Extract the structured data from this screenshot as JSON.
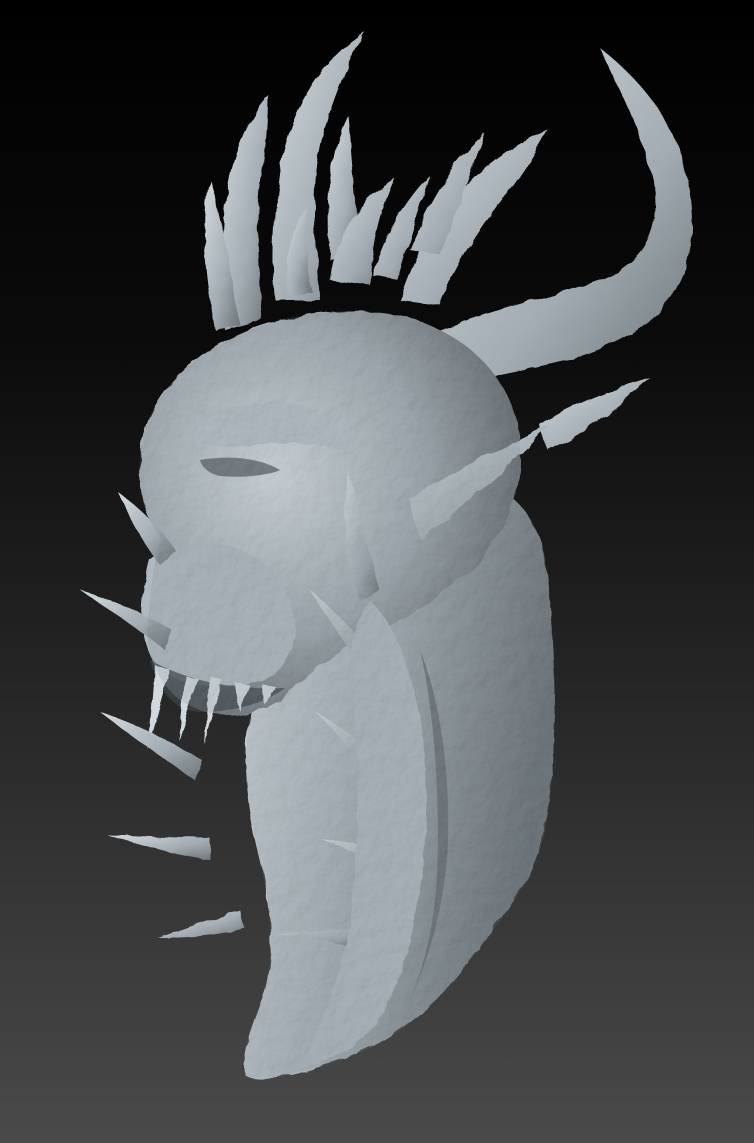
{
  "scene": {
    "subject": "dragon-head-sculpt",
    "colors": {
      "background_top": "#000000",
      "background_bottom": "#4a4a4a",
      "material_light": "#c9d2d8",
      "material_mid": "#9aa4ab",
      "material_shadow": "#4e555a"
    }
  }
}
